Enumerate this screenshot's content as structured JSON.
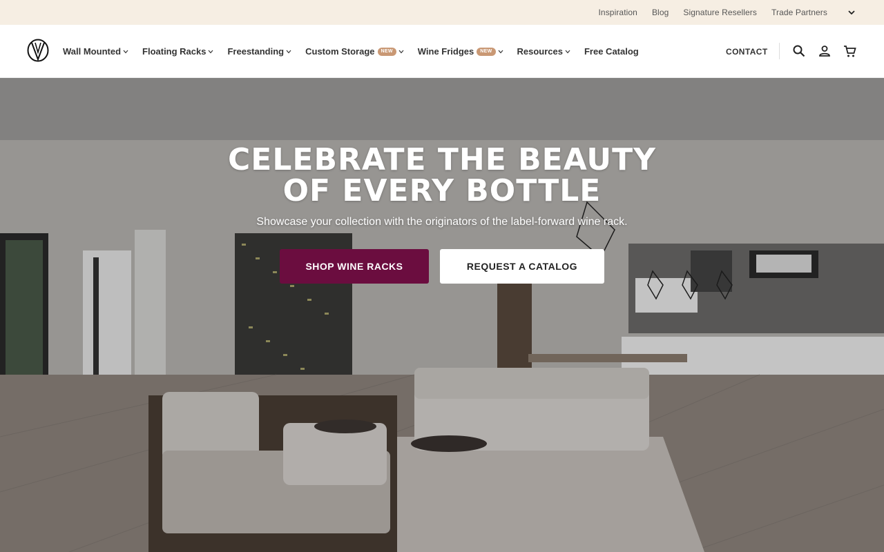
{
  "utility_bar": {
    "links": [
      "Inspiration",
      "Blog",
      "Signature Resellers",
      "Trade Partners"
    ]
  },
  "header": {
    "logo_alt": "V",
    "nav": [
      {
        "label": "Wall Mounted",
        "badge": ""
      },
      {
        "label": "Floating Racks",
        "badge": ""
      },
      {
        "label": "Freestanding",
        "badge": ""
      },
      {
        "label": "Custom Storage",
        "badge": "NEW"
      },
      {
        "label": "Wine Fridges",
        "badge": "NEW"
      },
      {
        "label": "Resources",
        "badge": ""
      },
      {
        "label": "Free Catalog",
        "badge": ""
      }
    ],
    "contact_label": "CONTACT"
  },
  "hero": {
    "title_line1": "CELEBRATE THE BEAUTY",
    "title_line2": "OF EVERY BOTTLE",
    "subtitle": "Showcase your collection with the originators of the label-forward wine rack.",
    "primary_cta": "SHOP WINE RACKS",
    "secondary_cta": "REQUEST A CATALOG"
  },
  "colors": {
    "utility_bg": "#f6eee3",
    "primary_button": "#6b0d3f",
    "badge": "#c99874"
  },
  "icons": [
    "chevron-down-icon",
    "search-icon",
    "account-icon",
    "cart-icon",
    "logo-icon"
  ]
}
